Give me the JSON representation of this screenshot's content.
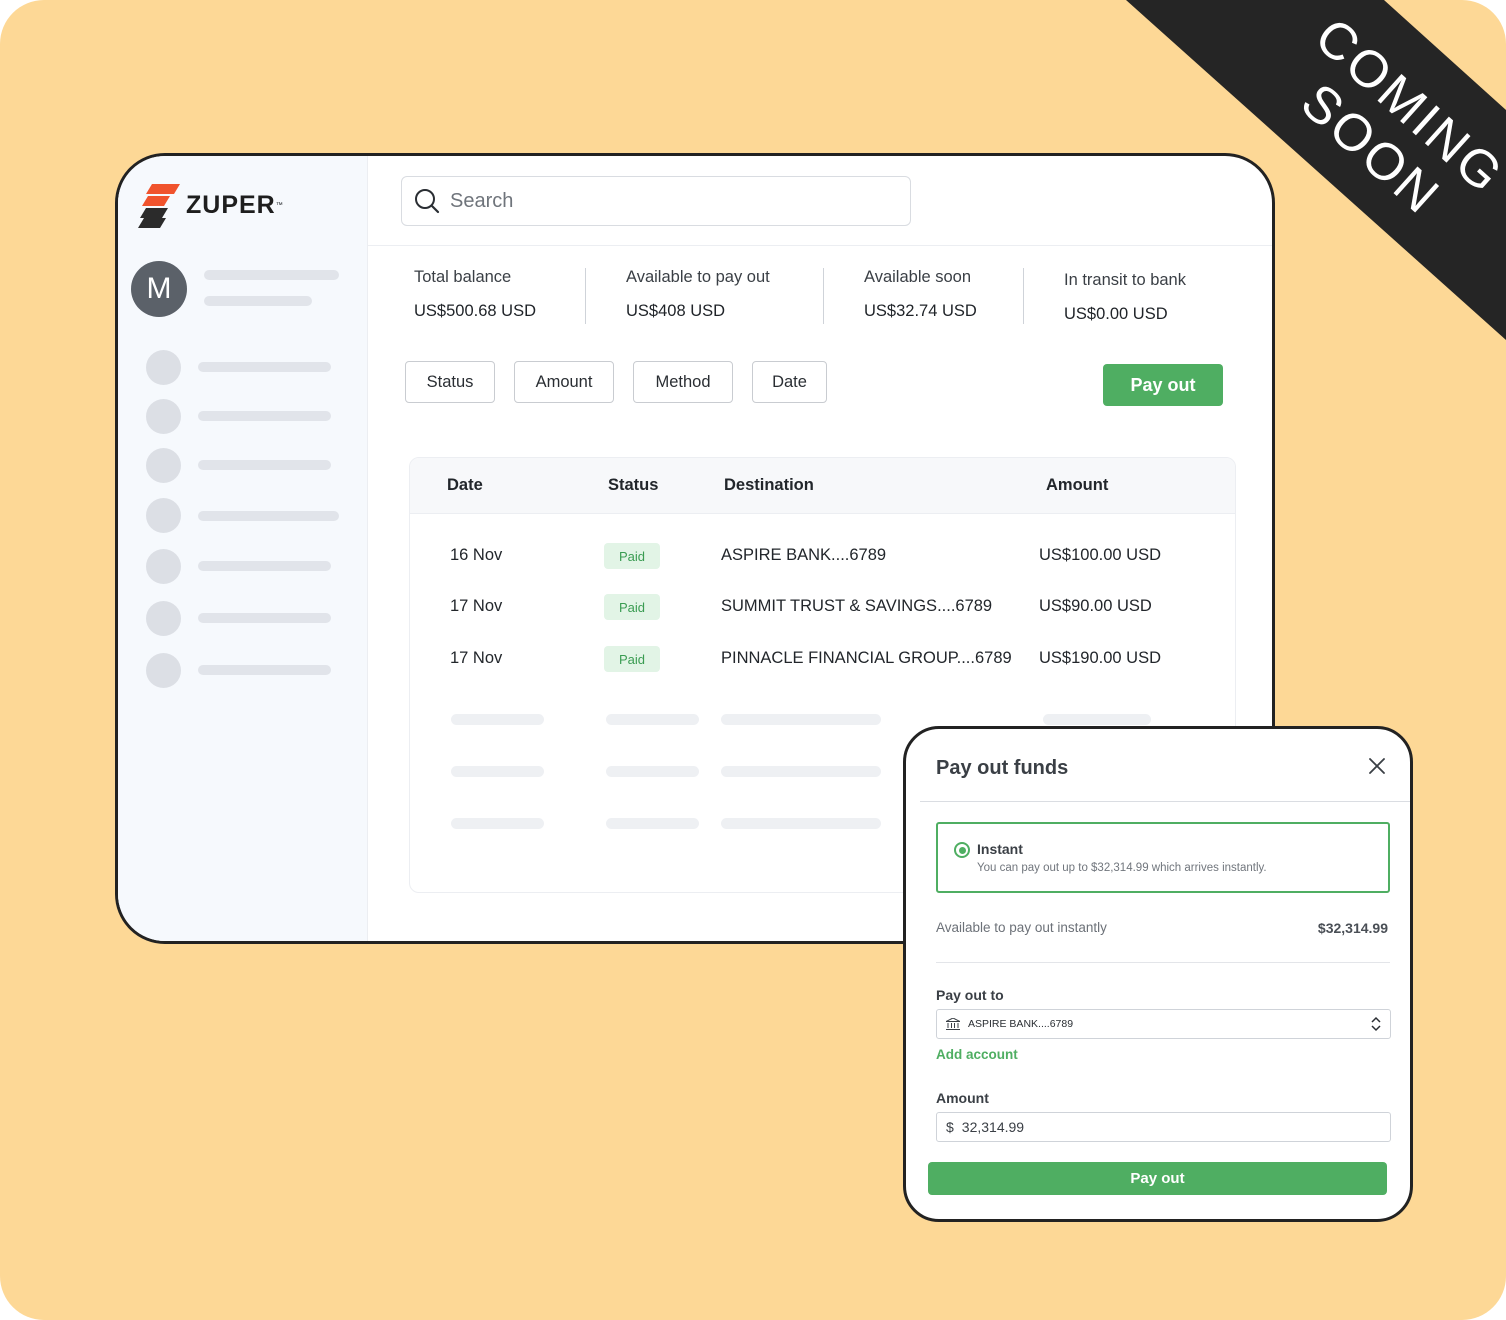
{
  "banner": {
    "ribbon_text": "COMING SOON"
  },
  "brand": {
    "name": "ZUPER",
    "trademark": "™"
  },
  "user": {
    "avatar_initial": "M"
  },
  "search": {
    "placeholder": "Search"
  },
  "stats": [
    {
      "label": "Total balance",
      "value": "US$500.68 USD"
    },
    {
      "label": "Available to pay out",
      "value": "US$408 USD"
    },
    {
      "label": "Available soon",
      "value": "US$32.74 USD"
    },
    {
      "label": "In transit to bank",
      "value": "US$0.00 USD"
    }
  ],
  "filters": [
    "Status",
    "Amount",
    "Method",
    "Date"
  ],
  "actions": {
    "payout_label": "Pay out"
  },
  "table": {
    "columns": [
      "Date",
      "Status",
      "Destination",
      "Amount"
    ],
    "rows": [
      {
        "date": "16 Nov",
        "status": "Paid",
        "destination": "ASPIRE BANK....6789",
        "amount": "US$100.00 USD"
      },
      {
        "date": "17 Nov",
        "status": "Paid",
        "destination": "SUMMIT TRUST & SAVINGS....6789",
        "amount": "US$90.00 USD"
      },
      {
        "date": "17 Nov",
        "status": "Paid",
        "destination": "PINNACLE FINANCIAL GROUP....6789",
        "amount": "US$190.00 USD"
      }
    ]
  },
  "modal": {
    "title": "Pay out funds",
    "option": {
      "title": "Instant",
      "description": "You can pay out up to $32,314.99 which arrives instantly."
    },
    "available_label": "Available to pay out instantly",
    "available_value": "$32,314.99",
    "payout_to_label": "Pay out to",
    "payout_to_value": "ASPIRE BANK....6789",
    "add_account_label": "Add account",
    "amount_label": "Amount",
    "amount_currency": "$",
    "amount_value": "32,314.99",
    "submit_label": "Pay out"
  },
  "colors": {
    "accent_green": "#4fae62",
    "background": "#fdd896",
    "ribbon": "#252525"
  }
}
